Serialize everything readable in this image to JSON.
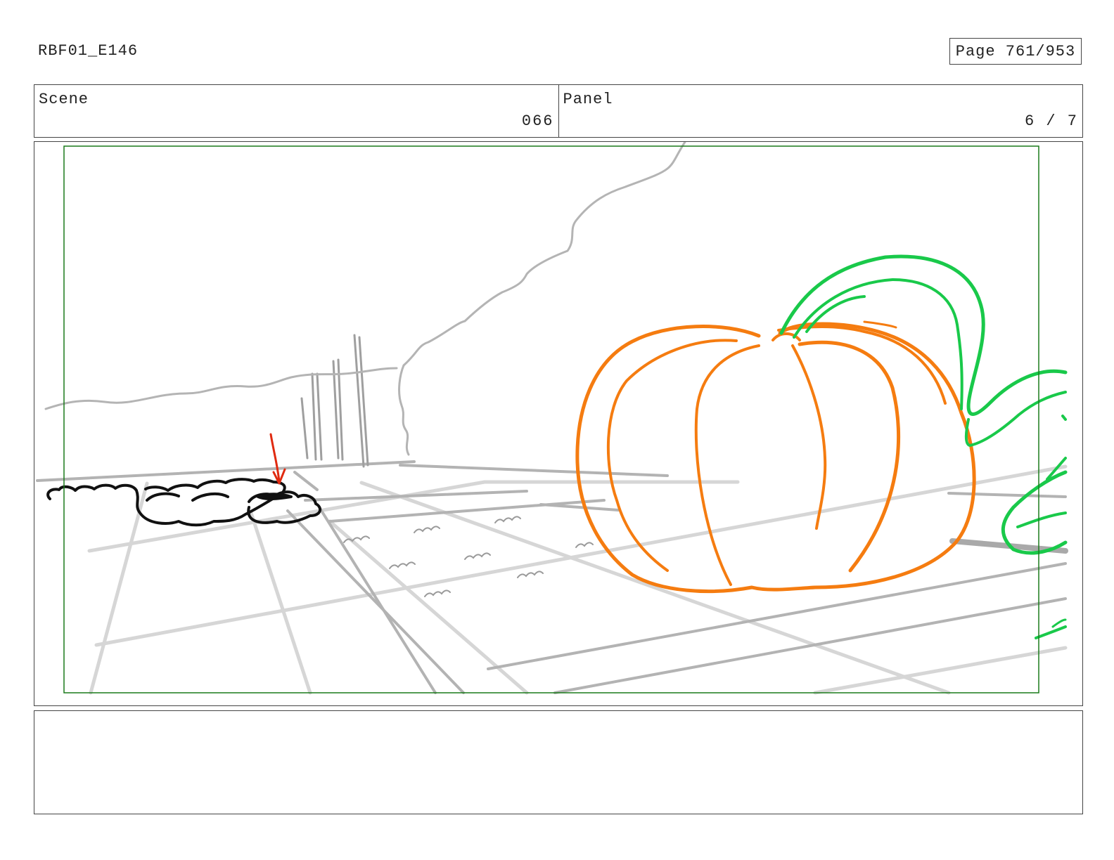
{
  "header": {
    "doc_id": "RBF01_E146",
    "page_label": "Page 761/953"
  },
  "info": {
    "scene_label": "Scene",
    "scene_value": "066",
    "panel_label": "Panel",
    "panel_value": "6 / 7"
  },
  "notes": {
    "text": ""
  },
  "colors": {
    "safe_area": "#1a7a1a",
    "pumpkin": "#f57c10",
    "vine": "#19c94a",
    "arrow": "#e02a10",
    "rough_sketch": "#b8b8b8",
    "bush": "#111111"
  }
}
